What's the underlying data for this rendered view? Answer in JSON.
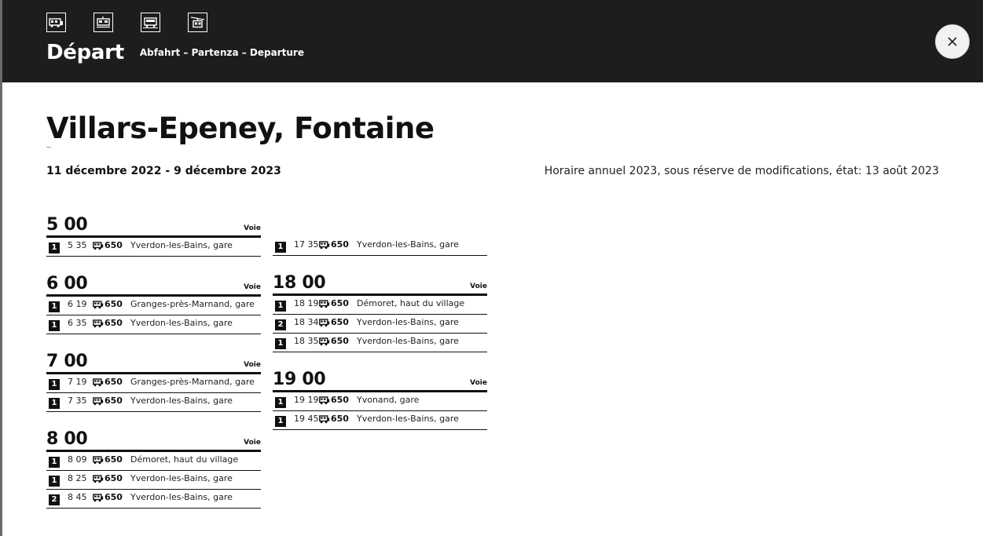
{
  "header": {
    "modes": [
      {
        "icon": "bus-icon"
      },
      {
        "icon": "tram-icon"
      },
      {
        "icon": "train-icon"
      },
      {
        "icon": "cable-car-icon"
      }
    ],
    "title": "Départ",
    "subtitle": "Abfahrt – Partenza – Departure",
    "close_icon": "close-icon"
  },
  "stop": {
    "name": "Villars-Epeney, Fontaine",
    "period": "11 décembre 2022 - 9 décembre 2023",
    "note": "Horaire annuel 2023, sous réserve de modifications, état: 13 août 2023"
  },
  "columns": [
    {
      "blocks": [
        {
          "hour": "5 00",
          "voie": "Voie",
          "rows": [
            {
              "platform": "1",
              "time": "5 35",
              "line": "650",
              "dest": "Yverdon-les-Bains, gare"
            }
          ]
        },
        {
          "hour": "6 00",
          "voie": "Voie",
          "rows": [
            {
              "platform": "1",
              "time": "6 19",
              "line": "650",
              "dest": "Granges-près-Marnand, gare"
            },
            {
              "platform": "1",
              "time": "6 35",
              "line": "650",
              "dest": "Yverdon-les-Bains, gare"
            }
          ]
        },
        {
          "hour": "7 00",
          "voie": "Voie",
          "rows": [
            {
              "platform": "1",
              "time": "7 19",
              "line": "650",
              "dest": "Granges-près-Marnand, gare"
            },
            {
              "platform": "1",
              "time": "7 35",
              "line": "650",
              "dest": "Yverdon-les-Bains, gare"
            }
          ]
        },
        {
          "hour": "8 00",
          "voie": "Voie",
          "rows": [
            {
              "platform": "1",
              "time": "8 09",
              "line": "650",
              "dest": "Démoret, haut du village"
            },
            {
              "platform": "1",
              "time": "8 25",
              "line": "650",
              "dest": "Yverdon-les-Bains, gare"
            },
            {
              "platform": "2",
              "time": "8 45",
              "line": "650",
              "dest": "Yverdon-les-Bains, gare"
            }
          ]
        }
      ]
    },
    {
      "blocks": [
        {
          "hour": "",
          "voie": "",
          "rows": [
            {
              "platform": "1",
              "time": "17 35",
              "line": "650",
              "dest": "Yverdon-les-Bains, gare"
            }
          ]
        },
        {
          "hour": "18 00",
          "voie": "Voie",
          "rows": [
            {
              "platform": "1",
              "time": "18 19",
              "line": "650",
              "dest": "Démoret, haut du village"
            },
            {
              "platform": "2",
              "time": "18 34",
              "line": "650",
              "dest": "Yverdon-les-Bains, gare"
            },
            {
              "platform": "1",
              "time": "18 35",
              "line": "650",
              "dest": "Yverdon-les-Bains, gare"
            }
          ]
        },
        {
          "hour": "19 00",
          "voie": "Voie",
          "rows": [
            {
              "platform": "1",
              "time": "19 19",
              "line": "650",
              "dest": "Yvonand, gare"
            },
            {
              "platform": "1",
              "time": "19 45",
              "line": "650",
              "dest": "Yverdon-les-Bains, gare"
            }
          ]
        }
      ]
    }
  ]
}
